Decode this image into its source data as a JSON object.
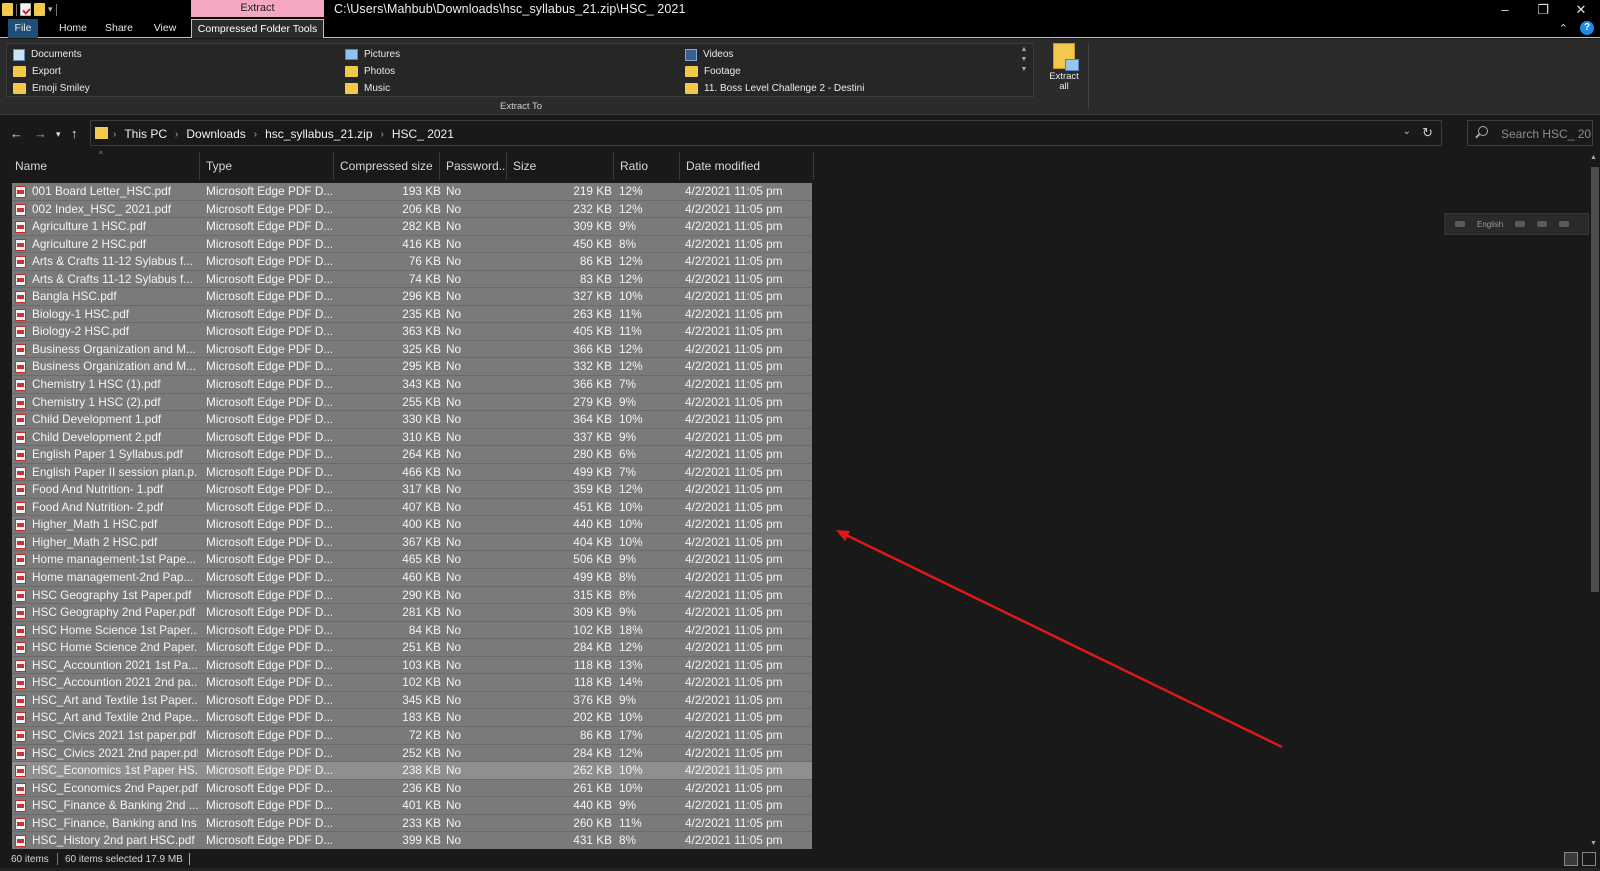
{
  "window": {
    "title_path": "C:\\Users\\Mahbub\\Downloads\\hsc_syllabus_21.zip\\HSC_ 2021",
    "context_header": "Extract",
    "minimize": "–",
    "restore": "❐",
    "close": "✕"
  },
  "ribbon_tabs": {
    "file": "File",
    "home": "Home",
    "share": "Share",
    "view": "View",
    "compressed": "Compressed Folder Tools"
  },
  "destinations": {
    "col1": [
      "Documents",
      "Export",
      "Emoji Smiley"
    ],
    "col2": [
      "Pictures",
      "Photos",
      "Music"
    ],
    "col3": [
      "Videos",
      "Footage",
      "11. Boss Level Challenge 2 - Destini"
    ],
    "group_label": "Extract To"
  },
  "extract_all": {
    "line1": "Extract",
    "line2": "all"
  },
  "address": {
    "crumbs": [
      "This PC",
      "Downloads",
      "hsc_syllabus_21.zip",
      "HSC_ 2021"
    ]
  },
  "search": {
    "placeholder": "Search HSC_ 20..."
  },
  "columns": {
    "name": "Name",
    "type": "Type",
    "compressed": "Compressed size",
    "password": "Password...",
    "size": "Size",
    "ratio": "Ratio",
    "date": "Date modified"
  },
  "files": [
    {
      "name": "001 Board Letter_HSC.pdf",
      "type": "Microsoft Edge PDF D...",
      "comp": "193 KB",
      "pw": "No",
      "size": "219 KB",
      "ratio": "12%",
      "date": "4/2/2021 11:05 pm"
    },
    {
      "name": "002 Index_HSC_ 2021.pdf",
      "type": "Microsoft Edge PDF D...",
      "comp": "206 KB",
      "pw": "No",
      "size": "232 KB",
      "ratio": "12%",
      "date": "4/2/2021 11:05 pm"
    },
    {
      "name": "Agriculture 1 HSC.pdf",
      "type": "Microsoft Edge PDF D...",
      "comp": "282 KB",
      "pw": "No",
      "size": "309 KB",
      "ratio": "9%",
      "date": "4/2/2021 11:05 pm"
    },
    {
      "name": "Agriculture 2 HSC.pdf",
      "type": "Microsoft Edge PDF D...",
      "comp": "416 KB",
      "pw": "No",
      "size": "450 KB",
      "ratio": "8%",
      "date": "4/2/2021 11:05 pm"
    },
    {
      "name": "Arts & Crafts 11-12 Sylabus f...",
      "type": "Microsoft Edge PDF D...",
      "comp": "76 KB",
      "pw": "No",
      "size": "86 KB",
      "ratio": "12%",
      "date": "4/2/2021 11:05 pm"
    },
    {
      "name": "Arts & Crafts 11-12 Sylabus f...",
      "type": "Microsoft Edge PDF D...",
      "comp": "74 KB",
      "pw": "No",
      "size": "83 KB",
      "ratio": "12%",
      "date": "4/2/2021 11:05 pm"
    },
    {
      "name": "Bangla HSC.pdf",
      "type": "Microsoft Edge PDF D...",
      "comp": "296 KB",
      "pw": "No",
      "size": "327 KB",
      "ratio": "10%",
      "date": "4/2/2021 11:05 pm"
    },
    {
      "name": "Biology-1 HSC.pdf",
      "type": "Microsoft Edge PDF D...",
      "comp": "235 KB",
      "pw": "No",
      "size": "263 KB",
      "ratio": "11%",
      "date": "4/2/2021 11:05 pm"
    },
    {
      "name": "Biology-2 HSC.pdf",
      "type": "Microsoft Edge PDF D...",
      "comp": "363 KB",
      "pw": "No",
      "size": "405 KB",
      "ratio": "11%",
      "date": "4/2/2021 11:05 pm"
    },
    {
      "name": "Business Organization and M...",
      "type": "Microsoft Edge PDF D...",
      "comp": "325 KB",
      "pw": "No",
      "size": "366 KB",
      "ratio": "12%",
      "date": "4/2/2021 11:05 pm"
    },
    {
      "name": "Business Organization and M...",
      "type": "Microsoft Edge PDF D...",
      "comp": "295 KB",
      "pw": "No",
      "size": "332 KB",
      "ratio": "12%",
      "date": "4/2/2021 11:05 pm"
    },
    {
      "name": "Chemistry  1 HSC  (1).pdf",
      "type": "Microsoft Edge PDF D...",
      "comp": "343 KB",
      "pw": "No",
      "size": "366 KB",
      "ratio": "7%",
      "date": "4/2/2021 11:05 pm"
    },
    {
      "name": "Chemistry  1 HSC  (2).pdf",
      "type": "Microsoft Edge PDF D...",
      "comp": "255 KB",
      "pw": "No",
      "size": "279 KB",
      "ratio": "9%",
      "date": "4/2/2021 11:05 pm"
    },
    {
      "name": "Child Development 1.pdf",
      "type": "Microsoft Edge PDF D...",
      "comp": "330 KB",
      "pw": "No",
      "size": "364 KB",
      "ratio": "10%",
      "date": "4/2/2021 11:05 pm"
    },
    {
      "name": "Child Development 2.pdf",
      "type": "Microsoft Edge PDF D...",
      "comp": "310 KB",
      "pw": "No",
      "size": "337 KB",
      "ratio": "9%",
      "date": "4/2/2021 11:05 pm"
    },
    {
      "name": "English Paper 1 Syllabus.pdf",
      "type": "Microsoft Edge PDF D...",
      "comp": "264 KB",
      "pw": "No",
      "size": "280 KB",
      "ratio": "6%",
      "date": "4/2/2021 11:05 pm"
    },
    {
      "name": "English Paper II session plan.p...",
      "type": "Microsoft Edge PDF D...",
      "comp": "466 KB",
      "pw": "No",
      "size": "499 KB",
      "ratio": "7%",
      "date": "4/2/2021 11:05 pm"
    },
    {
      "name": "Food And Nutrition- 1.pdf",
      "type": "Microsoft Edge PDF D...",
      "comp": "317 KB",
      "pw": "No",
      "size": "359 KB",
      "ratio": "12%",
      "date": "4/2/2021 11:05 pm"
    },
    {
      "name": "Food And Nutrition- 2.pdf",
      "type": "Microsoft Edge PDF D...",
      "comp": "407 KB",
      "pw": "No",
      "size": "451 KB",
      "ratio": "10%",
      "date": "4/2/2021 11:05 pm"
    },
    {
      "name": "Higher_Math 1 HSC.pdf",
      "type": "Microsoft Edge PDF D...",
      "comp": "400 KB",
      "pw": "No",
      "size": "440 KB",
      "ratio": "10%",
      "date": "4/2/2021 11:05 pm"
    },
    {
      "name": "Higher_Math 2 HSC.pdf",
      "type": "Microsoft Edge PDF D...",
      "comp": "367 KB",
      "pw": "No",
      "size": "404 KB",
      "ratio": "10%",
      "date": "4/2/2021 11:05 pm"
    },
    {
      "name": "Home management-1st Pape...",
      "type": "Microsoft Edge PDF D...",
      "comp": "465 KB",
      "pw": "No",
      "size": "506 KB",
      "ratio": "9%",
      "date": "4/2/2021 11:05 pm"
    },
    {
      "name": "Home management-2nd Pap...",
      "type": "Microsoft Edge PDF D...",
      "comp": "460 KB",
      "pw": "No",
      "size": "499 KB",
      "ratio": "8%",
      "date": "4/2/2021 11:05 pm"
    },
    {
      "name": "HSC Geography 1st Paper.pdf",
      "type": "Microsoft Edge PDF D...",
      "comp": "290 KB",
      "pw": "No",
      "size": "315 KB",
      "ratio": "8%",
      "date": "4/2/2021 11:05 pm"
    },
    {
      "name": "HSC Geography 2nd Paper.pdf",
      "type": "Microsoft Edge PDF D...",
      "comp": "281 KB",
      "pw": "No",
      "size": "309 KB",
      "ratio": "9%",
      "date": "4/2/2021 11:05 pm"
    },
    {
      "name": "HSC Home Science 1st Paper....",
      "type": "Microsoft Edge PDF D...",
      "comp": "84 KB",
      "pw": "No",
      "size": "102 KB",
      "ratio": "18%",
      "date": "4/2/2021 11:05 pm"
    },
    {
      "name": "HSC Home Science 2nd Paper....",
      "type": "Microsoft Edge PDF D...",
      "comp": "251 KB",
      "pw": "No",
      "size": "284 KB",
      "ratio": "12%",
      "date": "4/2/2021 11:05 pm"
    },
    {
      "name": "HSC_Accountion 2021 1st Pa...",
      "type": "Microsoft Edge PDF D...",
      "comp": "103 KB",
      "pw": "No",
      "size": "118 KB",
      "ratio": "13%",
      "date": "4/2/2021 11:05 pm"
    },
    {
      "name": "HSC_Accountion 2021 2nd pa...",
      "type": "Microsoft Edge PDF D...",
      "comp": "102 KB",
      "pw": "No",
      "size": "118 KB",
      "ratio": "14%",
      "date": "4/2/2021 11:05 pm"
    },
    {
      "name": "HSC_Art and Textile 1st Paper....",
      "type": "Microsoft Edge PDF D...",
      "comp": "345 KB",
      "pw": "No",
      "size": "376 KB",
      "ratio": "9%",
      "date": "4/2/2021 11:05 pm"
    },
    {
      "name": "HSC_Art and Textile 2nd Pape...",
      "type": "Microsoft Edge PDF D...",
      "comp": "183 KB",
      "pw": "No",
      "size": "202 KB",
      "ratio": "10%",
      "date": "4/2/2021 11:05 pm"
    },
    {
      "name": "HSC_Civics 2021 1st paper.pdf",
      "type": "Microsoft Edge PDF D...",
      "comp": "72 KB",
      "pw": "No",
      "size": "86 KB",
      "ratio": "17%",
      "date": "4/2/2021 11:05 pm"
    },
    {
      "name": "HSC_Civics 2021 2nd paper.pdf",
      "type": "Microsoft Edge PDF D...",
      "comp": "252 KB",
      "pw": "No",
      "size": "284 KB",
      "ratio": "12%",
      "date": "4/2/2021 11:05 pm"
    },
    {
      "name": "HSC_Economics 1st Paper HS...",
      "type": "Microsoft Edge PDF D...",
      "comp": "238 KB",
      "pw": "No",
      "size": "262 KB",
      "ratio": "10%",
      "date": "4/2/2021 11:05 pm"
    },
    {
      "name": "HSC_Economics 2nd Paper.pdf",
      "type": "Microsoft Edge PDF D...",
      "comp": "236 KB",
      "pw": "No",
      "size": "261 KB",
      "ratio": "10%",
      "date": "4/2/2021 11:05 pm"
    },
    {
      "name": "HSC_Finance & Banking 2nd ...",
      "type": "Microsoft Edge PDF D...",
      "comp": "401 KB",
      "pw": "No",
      "size": "440 KB",
      "ratio": "9%",
      "date": "4/2/2021 11:05 pm"
    },
    {
      "name": "HSC_Finance, Banking and Ins...",
      "type": "Microsoft Edge PDF D...",
      "comp": "233 KB",
      "pw": "No",
      "size": "260 KB",
      "ratio": "11%",
      "date": "4/2/2021 11:05 pm"
    },
    {
      "name": "HSC_History 2nd part HSC.pdf",
      "type": "Microsoft Edge PDF D...",
      "comp": "399 KB",
      "pw": "No",
      "size": "431 KB",
      "ratio": "8%",
      "date": "4/2/2021 11:05 pm"
    }
  ],
  "highlighted_row": 33,
  "language_bar": {
    "label": "English"
  },
  "status": {
    "items": "60 items",
    "selected": "60 items selected  17.9 MB"
  },
  "colors": {
    "accent": "#f5a7bf",
    "selection_row": "#7a7a7a",
    "annotation_arrow": "#e01818"
  }
}
